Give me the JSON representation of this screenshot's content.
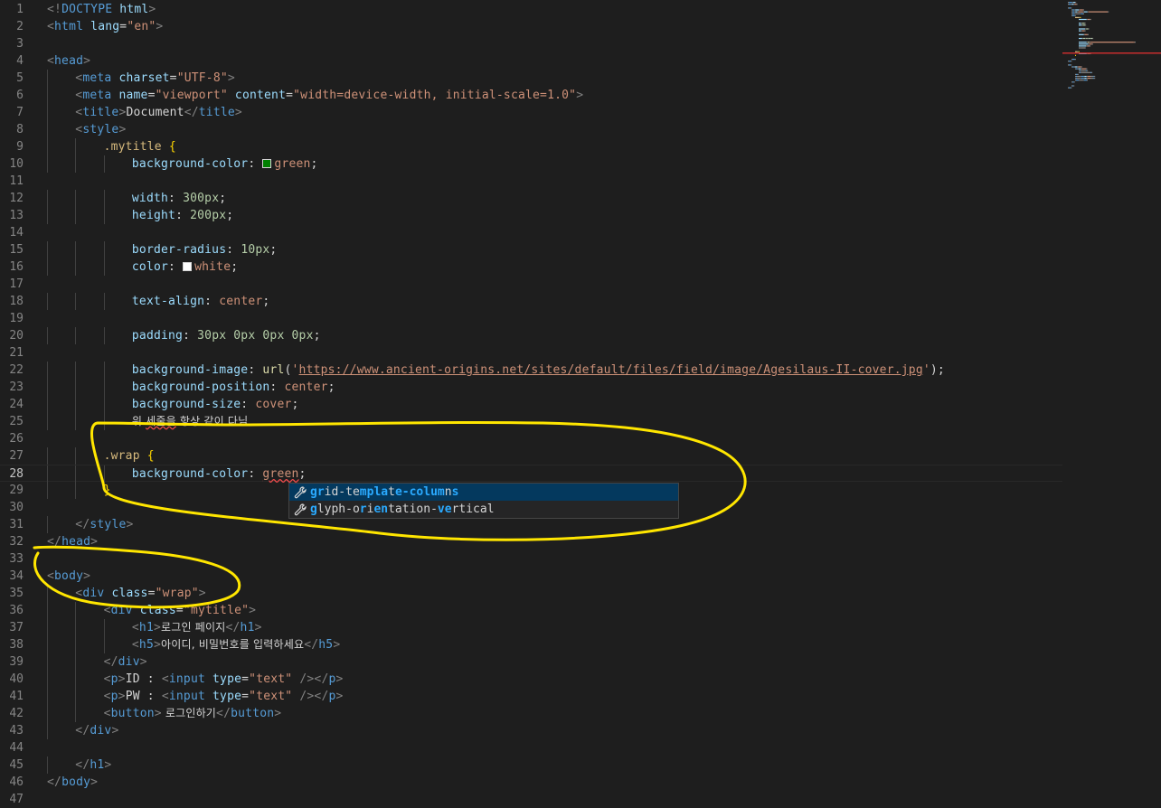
{
  "editor": {
    "lines": [
      {
        "n": "1",
        "indent": 0,
        "tokens": [
          [
            "punc",
            "<!"
          ],
          [
            "tag",
            "DOCTYPE"
          ],
          [
            "text",
            " "
          ],
          [
            "attr",
            "html"
          ],
          [
            "punc",
            ">"
          ]
        ]
      },
      {
        "n": "2",
        "indent": 0,
        "tokens": [
          [
            "punc",
            "<"
          ],
          [
            "tag",
            "html"
          ],
          [
            "text",
            " "
          ],
          [
            "attr",
            "lang"
          ],
          [
            "text",
            "="
          ],
          [
            "str",
            "\"en\""
          ],
          [
            "punc",
            ">"
          ]
        ]
      },
      {
        "n": "3",
        "indent": 0,
        "tokens": []
      },
      {
        "n": "4",
        "indent": 0,
        "tokens": [
          [
            "punc",
            "<"
          ],
          [
            "tag",
            "head"
          ],
          [
            "punc",
            ">"
          ]
        ]
      },
      {
        "n": "5",
        "indent": 1,
        "tokens": [
          [
            "punc",
            "<"
          ],
          [
            "tag",
            "meta"
          ],
          [
            "text",
            " "
          ],
          [
            "attr",
            "charset"
          ],
          [
            "text",
            "="
          ],
          [
            "str",
            "\"UTF-8\""
          ],
          [
            "punc",
            ">"
          ]
        ]
      },
      {
        "n": "6",
        "indent": 1,
        "tokens": [
          [
            "punc",
            "<"
          ],
          [
            "tag",
            "meta"
          ],
          [
            "text",
            " "
          ],
          [
            "attr",
            "name"
          ],
          [
            "text",
            "="
          ],
          [
            "str",
            "\"viewport\""
          ],
          [
            "text",
            " "
          ],
          [
            "attr",
            "content"
          ],
          [
            "text",
            "="
          ],
          [
            "str",
            "\"width=device-width, initial-scale=1.0\""
          ],
          [
            "punc",
            ">"
          ]
        ]
      },
      {
        "n": "7",
        "indent": 1,
        "tokens": [
          [
            "punc",
            "<"
          ],
          [
            "tag",
            "title"
          ],
          [
            "punc",
            ">"
          ],
          [
            "text",
            "Document"
          ],
          [
            "punc",
            "</"
          ],
          [
            "tag",
            "title"
          ],
          [
            "punc",
            ">"
          ]
        ]
      },
      {
        "n": "8",
        "indent": 1,
        "tokens": [
          [
            "punc",
            "<"
          ],
          [
            "tag",
            "style"
          ],
          [
            "punc",
            ">"
          ]
        ]
      },
      {
        "n": "9",
        "indent": 2,
        "tokens": [
          [
            "sel",
            ".mytitle"
          ],
          [
            "text",
            " "
          ],
          [
            "brace",
            "{"
          ]
        ]
      },
      {
        "n": "10",
        "indent": 3,
        "tokens": [
          [
            "prop",
            "background-color"
          ],
          [
            "text",
            ": "
          ],
          [
            "swatch",
            "#008000"
          ],
          [
            "val",
            "green"
          ],
          [
            "text",
            ";"
          ]
        ]
      },
      {
        "n": "11",
        "indent": 0,
        "tokens": []
      },
      {
        "n": "12",
        "indent": 3,
        "tokens": [
          [
            "prop",
            "width"
          ],
          [
            "text",
            ": "
          ],
          [
            "num",
            "300px"
          ],
          [
            "text",
            ";"
          ]
        ]
      },
      {
        "n": "13",
        "indent": 3,
        "tokens": [
          [
            "prop",
            "height"
          ],
          [
            "text",
            ": "
          ],
          [
            "num",
            "200px"
          ],
          [
            "text",
            ";"
          ]
        ]
      },
      {
        "n": "14",
        "indent": 0,
        "tokens": []
      },
      {
        "n": "15",
        "indent": 3,
        "tokens": [
          [
            "prop",
            "border-radius"
          ],
          [
            "text",
            ": "
          ],
          [
            "num",
            "10px"
          ],
          [
            "text",
            ";"
          ]
        ]
      },
      {
        "n": "16",
        "indent": 3,
        "tokens": [
          [
            "prop",
            "color"
          ],
          [
            "text",
            ": "
          ],
          [
            "swatch",
            "#ffffff"
          ],
          [
            "val",
            "white"
          ],
          [
            "text",
            ";"
          ]
        ]
      },
      {
        "n": "17",
        "indent": 0,
        "tokens": []
      },
      {
        "n": "18",
        "indent": 3,
        "tokens": [
          [
            "prop",
            "text-align"
          ],
          [
            "text",
            ": "
          ],
          [
            "val",
            "center"
          ],
          [
            "text",
            ";"
          ]
        ]
      },
      {
        "n": "19",
        "indent": 0,
        "tokens": []
      },
      {
        "n": "20",
        "indent": 3,
        "tokens": [
          [
            "prop",
            "padding"
          ],
          [
            "text",
            ": "
          ],
          [
            "num",
            "30px"
          ],
          [
            "text",
            " "
          ],
          [
            "num",
            "0px"
          ],
          [
            "text",
            " "
          ],
          [
            "num",
            "0px"
          ],
          [
            "text",
            " "
          ],
          [
            "num",
            "0px"
          ],
          [
            "text",
            ";"
          ]
        ]
      },
      {
        "n": "21",
        "indent": 0,
        "tokens": []
      },
      {
        "n": "22",
        "indent": 3,
        "tokens": [
          [
            "prop",
            "background-image"
          ],
          [
            "text",
            ": "
          ],
          [
            "fn",
            "url"
          ],
          [
            "text",
            "("
          ],
          [
            "val",
            "'"
          ],
          [
            "url",
            "https://www.ancient-origins.net/sites/default/files/field/image/Agesilaus-II-cover.jpg"
          ],
          [
            "val",
            "'"
          ],
          [
            "text",
            ");"
          ]
        ]
      },
      {
        "n": "23",
        "indent": 3,
        "tokens": [
          [
            "prop",
            "background-position"
          ],
          [
            "text",
            ": "
          ],
          [
            "val",
            "center"
          ],
          [
            "text",
            ";"
          ]
        ]
      },
      {
        "n": "24",
        "indent": 3,
        "tokens": [
          [
            "prop",
            "background-size"
          ],
          [
            "text",
            ": "
          ],
          [
            "val",
            "cover"
          ],
          [
            "text",
            ";"
          ]
        ]
      },
      {
        "n": "25",
        "indent": 3,
        "tokens": [
          [
            "kor",
            "위 "
          ],
          [
            "korerr",
            "세줄을"
          ],
          [
            "kor",
            " 항상 같이 다님"
          ]
        ]
      },
      {
        "n": "26",
        "indent": 0,
        "tokens": []
      },
      {
        "n": "27",
        "indent": 2,
        "tokens": [
          [
            "sel",
            ".wrap"
          ],
          [
            "text",
            " "
          ],
          [
            "brace",
            "{"
          ]
        ]
      },
      {
        "n": "28",
        "indent": 3,
        "tokens": [
          [
            "prop",
            "background-color"
          ],
          [
            "text",
            ": "
          ],
          [
            "errv",
            "green"
          ],
          [
            "text",
            ";"
          ]
        ]
      },
      {
        "n": "29",
        "indent": 2,
        "tokens": [
          [
            "brace",
            "}"
          ]
        ]
      },
      {
        "n": "30",
        "indent": 0,
        "tokens": []
      },
      {
        "n": "31",
        "indent": 1,
        "tokens": [
          [
            "punc",
            "</"
          ],
          [
            "tag",
            "style"
          ],
          [
            "punc",
            ">"
          ]
        ]
      },
      {
        "n": "32",
        "indent": 0,
        "tokens": [
          [
            "punc",
            "</"
          ],
          [
            "tag",
            "head"
          ],
          [
            "punc",
            ">"
          ]
        ]
      },
      {
        "n": "33",
        "indent": 0,
        "tokens": []
      },
      {
        "n": "34",
        "indent": 0,
        "tokens": [
          [
            "punc",
            "<"
          ],
          [
            "tag",
            "body"
          ],
          [
            "punc",
            ">"
          ]
        ]
      },
      {
        "n": "35",
        "indent": 1,
        "tokens": [
          [
            "punc",
            "<"
          ],
          [
            "tag",
            "div"
          ],
          [
            "text",
            " "
          ],
          [
            "attr",
            "class"
          ],
          [
            "text",
            "="
          ],
          [
            "str",
            "\"wrap\""
          ],
          [
            "punc",
            ">"
          ]
        ]
      },
      {
        "n": "36",
        "indent": 2,
        "tokens": [
          [
            "punc",
            "<"
          ],
          [
            "tag",
            "div"
          ],
          [
            "text",
            " "
          ],
          [
            "attr",
            "class"
          ],
          [
            "text",
            "="
          ],
          [
            "str",
            "\"mytitle\""
          ],
          [
            "punc",
            ">"
          ]
        ]
      },
      {
        "n": "37",
        "indent": 3,
        "tokens": [
          [
            "punc",
            "<"
          ],
          [
            "tag",
            "h1"
          ],
          [
            "punc",
            ">"
          ],
          [
            "kor",
            "로그인 페이지"
          ],
          [
            "punc",
            "</"
          ],
          [
            "tag",
            "h1"
          ],
          [
            "punc",
            ">"
          ]
        ]
      },
      {
        "n": "38",
        "indent": 3,
        "tokens": [
          [
            "punc",
            "<"
          ],
          [
            "tag",
            "h5"
          ],
          [
            "punc",
            ">"
          ],
          [
            "kor",
            "아이디, 비밀번호를 입력하세요"
          ],
          [
            "punc",
            "</"
          ],
          [
            "tag",
            "h5"
          ],
          [
            "punc",
            ">"
          ]
        ]
      },
      {
        "n": "39",
        "indent": 2,
        "tokens": [
          [
            "punc",
            "</"
          ],
          [
            "tag",
            "div"
          ],
          [
            "punc",
            ">"
          ]
        ]
      },
      {
        "n": "40",
        "indent": 2,
        "tokens": [
          [
            "punc",
            "<"
          ],
          [
            "tag",
            "p"
          ],
          [
            "punc",
            ">"
          ],
          [
            "text",
            "ID : "
          ],
          [
            "punc",
            "<"
          ],
          [
            "tag",
            "input"
          ],
          [
            "text",
            " "
          ],
          [
            "attr",
            "type"
          ],
          [
            "text",
            "="
          ],
          [
            "str",
            "\"text\""
          ],
          [
            "text",
            " "
          ],
          [
            "punc",
            "/></"
          ],
          [
            "tag",
            "p"
          ],
          [
            "punc",
            ">"
          ]
        ]
      },
      {
        "n": "41",
        "indent": 2,
        "tokens": [
          [
            "punc",
            "<"
          ],
          [
            "tag",
            "p"
          ],
          [
            "punc",
            ">"
          ],
          [
            "text",
            "PW : "
          ],
          [
            "punc",
            "<"
          ],
          [
            "tag",
            "input"
          ],
          [
            "text",
            " "
          ],
          [
            "attr",
            "type"
          ],
          [
            "text",
            "="
          ],
          [
            "str",
            "\"text\""
          ],
          [
            "text",
            " "
          ],
          [
            "punc",
            "/></"
          ],
          [
            "tag",
            "p"
          ],
          [
            "punc",
            ">"
          ]
        ]
      },
      {
        "n": "42",
        "indent": 2,
        "tokens": [
          [
            "punc",
            "<"
          ],
          [
            "tag",
            "button"
          ],
          [
            "punc",
            ">"
          ],
          [
            "kor",
            " 로그인하기"
          ],
          [
            "punc",
            "</"
          ],
          [
            "tag",
            "button"
          ],
          [
            "punc",
            ">"
          ]
        ]
      },
      {
        "n": "43",
        "indent": 1,
        "tokens": [
          [
            "punc",
            "</"
          ],
          [
            "tag",
            "div"
          ],
          [
            "punc",
            ">"
          ]
        ]
      },
      {
        "n": "44",
        "indent": 0,
        "tokens": []
      },
      {
        "n": "45",
        "indent": 1,
        "tokens": [
          [
            "punc",
            "</"
          ],
          [
            "tag",
            "h1"
          ],
          [
            "punc",
            ">"
          ]
        ]
      },
      {
        "n": "46",
        "indent": 0,
        "tokens": [
          [
            "punc",
            "</"
          ],
          [
            "tag",
            "body"
          ],
          [
            "punc",
            ">"
          ]
        ]
      },
      {
        "n": "47",
        "indent": 0,
        "tokens": []
      }
    ],
    "current_line": "28"
  },
  "suggest": {
    "items": [
      {
        "parts": [
          [
            "h",
            "gr"
          ],
          [
            "t",
            "id-te"
          ],
          [
            "h",
            "mpla"
          ],
          [
            "t",
            "t"
          ],
          [
            "h",
            "e-colum"
          ],
          [
            "t",
            "n"
          ],
          [
            "h",
            "s"
          ]
        ],
        "label": "grid-template-columns",
        "icon": "wrench-icon",
        "selected": true
      },
      {
        "parts": [
          [
            "h",
            "g"
          ],
          [
            "t",
            "lyph-o"
          ],
          [
            "h",
            "r"
          ],
          [
            "t",
            "i"
          ],
          [
            "h",
            "en"
          ],
          [
            "t",
            "tation-"
          ],
          [
            "h",
            "ve"
          ],
          [
            "t",
            "rtical"
          ]
        ],
        "label": "glyph-orientation-vertical",
        "icon": "wrench-icon",
        "selected": false
      }
    ]
  },
  "annotations": {
    "stroke_color": "#ffe600"
  },
  "colors": {
    "background": "#1e1e1e",
    "tag": "#569cd6",
    "attribute": "#9cdcfe",
    "string": "#ce9178",
    "selector": "#d7ba7d",
    "number": "#b5cea8"
  }
}
